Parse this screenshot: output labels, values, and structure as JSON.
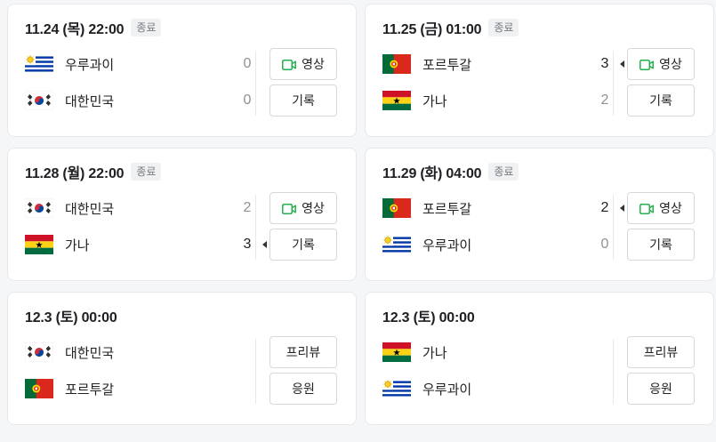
{
  "colors": {
    "win": "#1e1e23",
    "lose": "#8e9196",
    "video_icon": "#22b14c"
  },
  "matches": [
    {
      "datetime": "11.24 (목) 22:00",
      "status": "종료",
      "teams": [
        {
          "name": "우루과이",
          "flag": "uruguay",
          "score": "0",
          "win": false
        },
        {
          "name": "대한민국",
          "flag": "korea",
          "score": "0",
          "win": false
        }
      ],
      "buttons": [
        {
          "label": "영상",
          "icon": "video-icon"
        },
        {
          "label": "기록",
          "icon": ""
        }
      ]
    },
    {
      "datetime": "11.25 (금) 01:00",
      "status": "종료",
      "teams": [
        {
          "name": "포르투갈",
          "flag": "portugal",
          "score": "3",
          "win": true
        },
        {
          "name": "가나",
          "flag": "ghana",
          "score": "2",
          "win": false
        }
      ],
      "buttons": [
        {
          "label": "영상",
          "icon": "video-icon"
        },
        {
          "label": "기록",
          "icon": ""
        }
      ]
    },
    {
      "datetime": "11.28 (월) 22:00",
      "status": "종료",
      "teams": [
        {
          "name": "대한민국",
          "flag": "korea",
          "score": "2",
          "win": false
        },
        {
          "name": "가나",
          "flag": "ghana",
          "score": "3",
          "win": true
        }
      ],
      "buttons": [
        {
          "label": "영상",
          "icon": "video-icon"
        },
        {
          "label": "기록",
          "icon": ""
        }
      ]
    },
    {
      "datetime": "11.29 (화) 04:00",
      "status": "종료",
      "teams": [
        {
          "name": "포르투갈",
          "flag": "portugal",
          "score": "2",
          "win": true
        },
        {
          "name": "우루과이",
          "flag": "uruguay",
          "score": "0",
          "win": false
        }
      ],
      "buttons": [
        {
          "label": "영상",
          "icon": "video-icon"
        },
        {
          "label": "기록",
          "icon": ""
        }
      ]
    },
    {
      "datetime": "12.3 (토) 00:00",
      "status": "",
      "teams": [
        {
          "name": "대한민국",
          "flag": "korea",
          "score": "",
          "win": false
        },
        {
          "name": "포르투갈",
          "flag": "portugal",
          "score": "",
          "win": false
        }
      ],
      "buttons": [
        {
          "label": "프리뷰",
          "icon": ""
        },
        {
          "label": "응원",
          "icon": ""
        }
      ]
    },
    {
      "datetime": "12.3 (토) 00:00",
      "status": "",
      "teams": [
        {
          "name": "가나",
          "flag": "ghana",
          "score": "",
          "win": false
        },
        {
          "name": "우루과이",
          "flag": "uruguay",
          "score": "",
          "win": false
        }
      ],
      "buttons": [
        {
          "label": "프리뷰",
          "icon": ""
        },
        {
          "label": "응원",
          "icon": ""
        }
      ]
    }
  ]
}
